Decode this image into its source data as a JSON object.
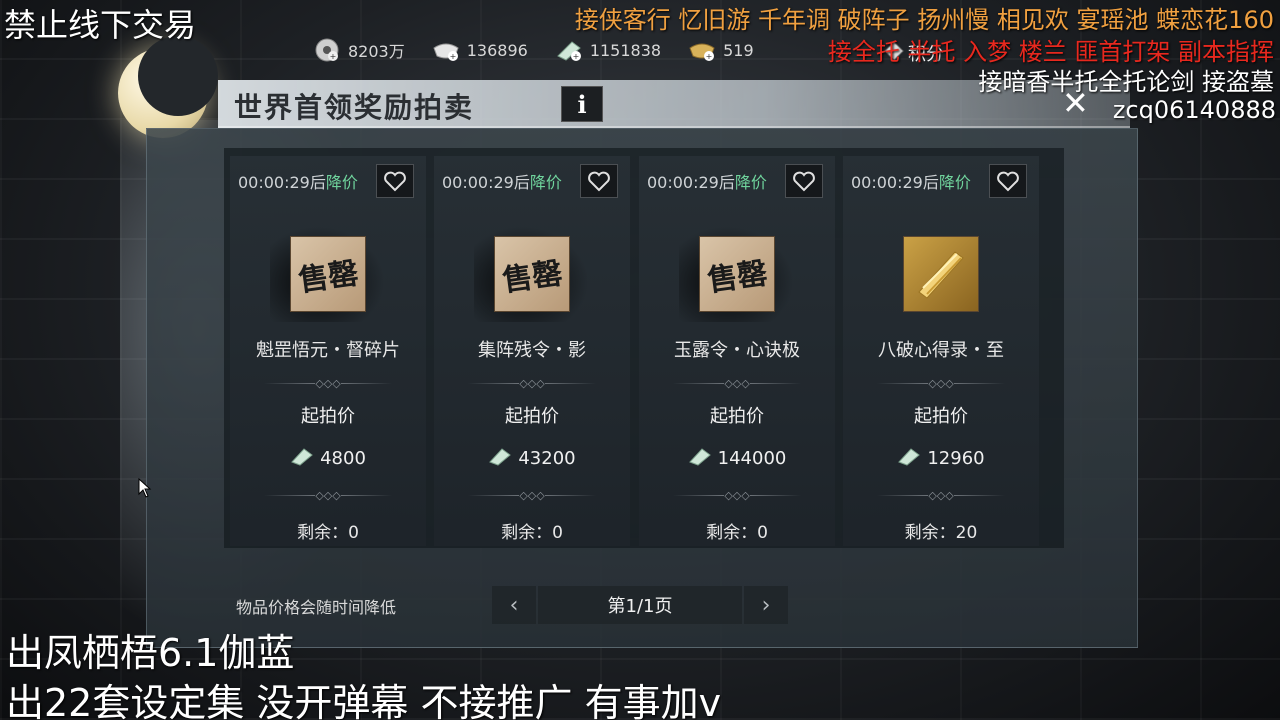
{
  "overlay": {
    "top_left": "禁止线下交易",
    "top_right_1": "接侠客行 忆旧游 千年调 破阵子 扬州慢 相见欢 宴瑶池 蝶恋花160",
    "top_right_2": "接全托 半托 入梦 楼兰 匪首打架 副本指挥",
    "top_right_3": "接暗香半托全托论剑 接盗墓",
    "wechat_id": "zcq06140888",
    "bottom_1": "出凤栖梧6.1伽蓝",
    "bottom_2": "出22套设定集 没开弹幕 不接推广 有事加v"
  },
  "currencies": [
    {
      "icon": "coin-reel-icon",
      "value": "8203万"
    },
    {
      "icon": "silver-ingot-icon",
      "value": "136896"
    },
    {
      "icon": "jade-ticket-icon",
      "value": "1151838"
    },
    {
      "icon": "gold-ingot-icon",
      "value": "519"
    }
  ],
  "points_label": "积分",
  "title": "世界首领奖励拍卖",
  "info_label": "i",
  "start_price_label": "起拍价",
  "cards": [
    {
      "timer": "00:00:29后",
      "drop": "降价",
      "name": "魁罡悟元・督碎片",
      "price": "4800",
      "remain": "剩余：0",
      "icon": "sold-seal-icon",
      "seal": "售罄"
    },
    {
      "timer": "00:00:29后",
      "drop": "降价",
      "name": "集阵残令・影",
      "price": "43200",
      "remain": "剩余：0",
      "icon": "sold-seal-icon",
      "seal": "售罄"
    },
    {
      "timer": "00:00:29后",
      "drop": "降价",
      "name": "玉露令・心诀极",
      "price": "144000",
      "remain": "剩余：0",
      "icon": "sold-seal-icon",
      "seal": "售罄"
    },
    {
      "timer": "00:00:29后",
      "drop": "降价",
      "name": "八破心得录・至",
      "price": "12960",
      "remain": "剩余：20",
      "icon": "gold-scroll-icon",
      "seal": ""
    }
  ],
  "footer_note": "物品价格会随时间降低",
  "pager": {
    "label": "第1/1页",
    "prev": "‹",
    "next": "›"
  },
  "close_label": "✕"
}
